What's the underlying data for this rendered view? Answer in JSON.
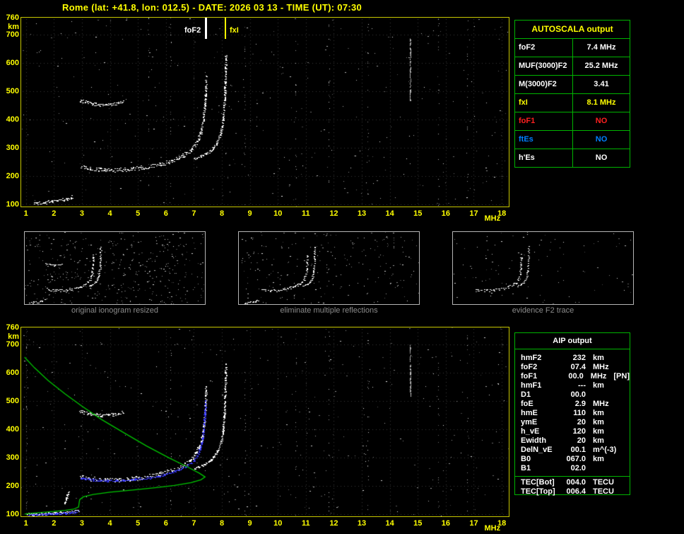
{
  "title": "Rome (lat: +41.8, lon: 012.5) - DATE: 2026 03 13 - TIME (UT): 07:30",
  "colors": {
    "background": "#000000",
    "title": "#ffff00",
    "axis": "#ffff00",
    "plot_border": "#c8c800",
    "table_border": "#00b400",
    "trace": "#ffffff",
    "profile_green": "#00c800",
    "restored_blue": "#3838ff",
    "no_red": "#ff2020",
    "no_blue": "#0080ff",
    "caption_gray": "#8c8c8c"
  },
  "autoscala_table": {
    "header": "AUTOSCALA output",
    "rows": [
      {
        "label": "foF2",
        "value": "7.4 MHz",
        "color": "#ffffff"
      },
      {
        "label": "MUF(3000)F2",
        "value": "25.2 MHz",
        "color": "#ffffff"
      },
      {
        "label": "M(3000)F2",
        "value": "3.41",
        "color": "#ffffff"
      },
      {
        "label": "fxI",
        "value": "8.1 MHz",
        "color": "#ffff00"
      },
      {
        "label": "foF1",
        "value": "NO",
        "color": "#ff2020"
      },
      {
        "label": "ftEs",
        "value": "NO",
        "color": "#0080ff"
      },
      {
        "label": "h'Es",
        "value": "NO",
        "color": "#ffffff"
      }
    ]
  },
  "aip_table": {
    "header": "AIP output",
    "rows": [
      {
        "label": "hmF2",
        "value": "232",
        "unit": "km",
        "note": ""
      },
      {
        "label": "foF2",
        "value": "07.4",
        "unit": "MHz",
        "note": ""
      },
      {
        "label": "foF1",
        "value": "00.0",
        "unit": "MHz",
        "note": "[PN]"
      },
      {
        "label": "hmF1",
        "value": "---",
        "unit": "km",
        "note": ""
      },
      {
        "label": "D1",
        "value": "00.0",
        "unit": "",
        "note": ""
      },
      {
        "label": "foE",
        "value": "2.9",
        "unit": "MHz",
        "note": ""
      },
      {
        "label": "hmE",
        "value": "110",
        "unit": "km",
        "note": ""
      },
      {
        "label": "ymE",
        "value": "20",
        "unit": "km",
        "note": ""
      },
      {
        "label": "h_vE",
        "value": "120",
        "unit": "km",
        "note": ""
      },
      {
        "label": "Ewidth",
        "value": "20",
        "unit": "km",
        "note": ""
      },
      {
        "label": "DelN_vE",
        "value": "00.1",
        "unit": "m^(-3)",
        "note": ""
      },
      {
        "label": "B0",
        "value": "067.0",
        "unit": "km",
        "note": ""
      },
      {
        "label": "B1",
        "value": "02.0",
        "unit": "",
        "note": ""
      }
    ],
    "tec_rows": [
      {
        "label": "TEC[Bot]",
        "value": "004.0",
        "unit": "TECU"
      },
      {
        "label": "TEC[Top]",
        "value": "006.4",
        "unit": "TECU"
      }
    ]
  },
  "mini_panels": [
    {
      "caption": "original ionogram resized",
      "noise": 420,
      "series": [
        "E-trace",
        "second-hop",
        "F2-o-trace",
        "F2-x-trace"
      ]
    },
    {
      "caption": "eliminate multiple reflections",
      "noise": 230,
      "series": [
        "E-trace",
        "F2-o-trace",
        "F2-x-trace"
      ]
    },
    {
      "caption": "evidence F2 trace",
      "noise": 100,
      "series": [
        "F2-o-trace",
        "F2-x-trace"
      ]
    }
  ],
  "chart_data": [
    {
      "id": "main_ionogram",
      "type": "scatter",
      "xlabel": "MHz",
      "ylabel": "km",
      "xlim": [
        0.83,
        18.25
      ],
      "ylim": [
        93,
        760
      ],
      "xticks": [
        1,
        2,
        3,
        4,
        5,
        6,
        7,
        8,
        9,
        10,
        11,
        12,
        13,
        14,
        15,
        16,
        17,
        18
      ],
      "yticks": [
        100,
        200,
        300,
        400,
        500,
        600,
        700,
        760
      ],
      "grid": true,
      "noise": 320,
      "noise_columns": [
        5.37,
        6.15,
        8.8,
        10.62,
        11.8,
        13.2,
        15.72,
        16.75
      ],
      "streaks": [
        {
          "x": 14.72,
          "h1": 470,
          "h2": 700,
          "n": 70
        }
      ],
      "markers": [
        {
          "label": "foF2",
          "x": 7.4,
          "color": "#ffffff",
          "side": "left"
        },
        {
          "label": "fxI",
          "x": 8.1,
          "color": "#ffff00",
          "side": "right"
        }
      ],
      "series": [
        {
          "name": "E-trace",
          "color": "#ffffff",
          "thickness": 3,
          "points": [
            [
              1.3,
              104
            ],
            [
              1.7,
              109
            ],
            [
              2.1,
              114
            ],
            [
              2.45,
              120
            ],
            [
              2.65,
              128
            ]
          ]
        },
        {
          "name": "second-hop",
          "color": "#ffffff",
          "thickness": 3,
          "points": [
            [
              2.9,
              468
            ],
            [
              3.3,
              457
            ],
            [
              3.7,
              452
            ],
            [
              4.1,
              455
            ],
            [
              4.45,
              463
            ]
          ]
        },
        {
          "name": "F2-o-trace",
          "color": "#ffffff",
          "thickness": 4,
          "points": [
            [
              2.95,
              232
            ],
            [
              3.3,
              226
            ],
            [
              3.8,
              222
            ],
            [
              4.3,
              222
            ],
            [
              4.8,
              226
            ],
            [
              5.3,
              233
            ],
            [
              5.8,
              243
            ],
            [
              6.2,
              255
            ],
            [
              6.6,
              272
            ],
            [
              6.9,
              295
            ],
            [
              7.1,
              322
            ],
            [
              7.25,
              358
            ],
            [
              7.33,
              400
            ],
            [
              7.38,
              452
            ],
            [
              7.41,
              508
            ],
            [
              7.42,
              548
            ]
          ]
        },
        {
          "name": "F2-x-trace",
          "color": "#ffffff",
          "thickness": 2,
          "points": [
            [
              7.0,
              262
            ],
            [
              7.3,
              273
            ],
            [
              7.6,
              291
            ],
            [
              7.8,
              316
            ],
            [
              7.95,
              352
            ],
            [
              8.03,
              398
            ],
            [
              8.08,
              455
            ],
            [
              8.1,
              515
            ],
            [
              8.12,
              580
            ],
            [
              8.13,
              628
            ]
          ]
        }
      ]
    },
    {
      "id": "profile_ionogram",
      "type": "scatter",
      "xlabel": "MHz",
      "ylabel": "km",
      "xlim": [
        0.83,
        18.25
      ],
      "ylim": [
        93,
        760
      ],
      "xticks": [
        1,
        2,
        3,
        4,
        5,
        6,
        7,
        8,
        9,
        10,
        11,
        12,
        13,
        14,
        15,
        16,
        17,
        18
      ],
      "yticks": [
        100,
        200,
        300,
        400,
        500,
        600,
        700,
        760
      ],
      "grid": true,
      "noise": 340,
      "noise_columns": [
        1.0,
        6.15,
        8.8,
        10.62,
        11.8,
        13.2,
        15.72,
        16.75
      ],
      "streaks": [
        {
          "x": 14.72,
          "h1": 515,
          "h2": 700,
          "n": 55
        }
      ],
      "markers": [],
      "series": [
        {
          "name": "E-trace",
          "color": "#ffffff",
          "thickness": 3,
          "points": [
            [
              1.05,
              100
            ],
            [
              1.5,
              102
            ],
            [
              2.0,
              104
            ],
            [
              2.5,
              107
            ],
            [
              2.85,
              112
            ]
          ]
        },
        {
          "name": "Es-spike",
          "color": "#ffffff",
          "thickness": 2,
          "points": [
            [
              2.38,
              138
            ],
            [
              2.44,
              158
            ],
            [
              2.5,
              178
            ]
          ]
        },
        {
          "name": "second-hop",
          "color": "#ffffff",
          "thickness": 3,
          "points": [
            [
              2.9,
              465
            ],
            [
              3.3,
              455
            ],
            [
              3.7,
              450
            ],
            [
              4.1,
              453
            ],
            [
              4.45,
              461
            ]
          ]
        },
        {
          "name": "F2-o-trace",
          "color": "#ffffff",
          "thickness": 4,
          "points": [
            [
              2.95,
              232
            ],
            [
              3.3,
              226
            ],
            [
              3.8,
              222
            ],
            [
              4.3,
              222
            ],
            [
              4.8,
              226
            ],
            [
              5.3,
              233
            ],
            [
              5.8,
              243
            ],
            [
              6.2,
              255
            ],
            [
              6.6,
              272
            ],
            [
              6.9,
              295
            ],
            [
              7.1,
              322
            ],
            [
              7.25,
              358
            ],
            [
              7.33,
              400
            ],
            [
              7.38,
              452
            ],
            [
              7.41,
              508
            ],
            [
              7.42,
              548
            ]
          ]
        },
        {
          "name": "F2-x-trace",
          "color": "#ffffff",
          "thickness": 2,
          "points": [
            [
              7.0,
              262
            ],
            [
              7.3,
              273
            ],
            [
              7.6,
              291
            ],
            [
              7.8,
              316
            ],
            [
              7.95,
              352
            ],
            [
              8.03,
              398
            ],
            [
              8.08,
              455
            ],
            [
              8.1,
              515
            ],
            [
              8.12,
              580
            ],
            [
              8.13,
              628
            ]
          ]
        },
        {
          "name": "restored-F2",
          "color": "#3838ff",
          "thickness": 2,
          "points": [
            [
              2.95,
              228
            ],
            [
              3.4,
              222
            ],
            [
              3.9,
              219
            ],
            [
              4.4,
              220
            ],
            [
              4.9,
              224
            ],
            [
              5.4,
              230
            ],
            [
              5.9,
              239
            ],
            [
              6.3,
              251
            ],
            [
              6.7,
              268
            ],
            [
              7.0,
              291
            ],
            [
              7.15,
              316
            ],
            [
              7.27,
              353
            ],
            [
              7.34,
              398
            ],
            [
              7.38,
              450
            ],
            [
              7.4,
              502
            ]
          ]
        },
        {
          "name": "restored-E",
          "color": "#3838ff",
          "thickness": 2,
          "points": [
            [
              1.1,
              99
            ],
            [
              1.6,
              101
            ],
            [
              2.1,
              103
            ],
            [
              2.6,
              106
            ],
            [
              2.85,
              110
            ]
          ]
        },
        {
          "name": "density-profile",
          "color": "#00c800",
          "style": "line",
          "points": [
            [
              0.95,
              655
            ],
            [
              1.3,
              618
            ],
            [
              1.8,
              572
            ],
            [
              2.4,
              525
            ],
            [
              3.0,
              482
            ],
            [
              3.7,
              435
            ],
            [
              4.5,
              388
            ],
            [
              5.3,
              342
            ],
            [
              6.1,
              300
            ],
            [
              6.8,
              266
            ],
            [
              7.2,
              245
            ],
            [
              7.4,
              232
            ],
            [
              7.25,
              222
            ],
            [
              6.9,
              212
            ],
            [
              6.3,
              202
            ],
            [
              5.6,
              194
            ],
            [
              4.8,
              186
            ],
            [
              4.0,
              178
            ],
            [
              3.4,
              170
            ],
            [
              3.05,
              162
            ],
            [
              2.92,
              152
            ],
            [
              2.9,
              140
            ],
            [
              2.88,
              126
            ],
            [
              2.7,
              118
            ],
            [
              2.4,
              114
            ],
            [
              2.0,
              110
            ],
            [
              1.6,
              107
            ],
            [
              1.2,
              104
            ],
            [
              0.95,
              101
            ]
          ]
        }
      ]
    }
  ]
}
